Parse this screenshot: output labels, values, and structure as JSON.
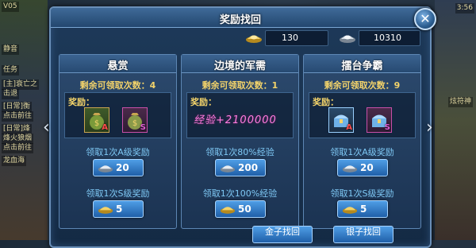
{
  "window": {
    "title": "奖励找回"
  },
  "background": {
    "left_lines": [
      "V05",
      "静音",
      "任务",
      "[主]衰亡之",
      "击退",
      "[日常]衡",
      "点击前往",
      "[日常]烽",
      "烽火狼烟",
      "点击前往",
      "龙血海"
    ],
    "right_lines": [
      "3:56",
      "炫符神"
    ]
  },
  "currency": {
    "gold_ingot": "130",
    "silver_ingot": "10310"
  },
  "cards": [
    {
      "title": "悬赏",
      "remaining": "剩余可领取次数：4",
      "reward_label": "奖励：",
      "items": [
        {
          "icon": "gold-money-bag-icon",
          "grade": "A"
        },
        {
          "icon": "silver-money-bag-icon",
          "grade": "S"
        }
      ],
      "claim_a_label": "领取1次A级奖励",
      "claim_a_value": "20",
      "claim_s_label": "领取1次S级奖励",
      "claim_s_value": "5"
    },
    {
      "title": "边境的军需",
      "remaining": "剩余可领取次数：1",
      "reward_label": "奖励：",
      "exp_text": "经验+2100000",
      "claim_a_label": "领取1次80%经验",
      "claim_a_value": "200",
      "claim_s_label": "领取1次100%经验",
      "claim_s_value": "50"
    },
    {
      "title": "擂台争霸",
      "remaining": "剩余可领取次数：9",
      "reward_label": "奖励：",
      "items": [
        {
          "icon": "treasure-chest-icon",
          "grade": "A"
        },
        {
          "icon": "treasure-chest-icon",
          "grade": "S"
        }
      ],
      "claim_a_label": "领取1次A级奖励",
      "claim_a_value": "20",
      "claim_s_label": "领取1次S级奖励",
      "claim_s_value": "5"
    }
  ],
  "bottom": {
    "gold_recover": "金子找回",
    "silver_recover": "银子找回"
  },
  "colors": {
    "panel": "#1e3a5a",
    "accent_gold": "#f3d36a",
    "button": "#2f7fcf"
  }
}
